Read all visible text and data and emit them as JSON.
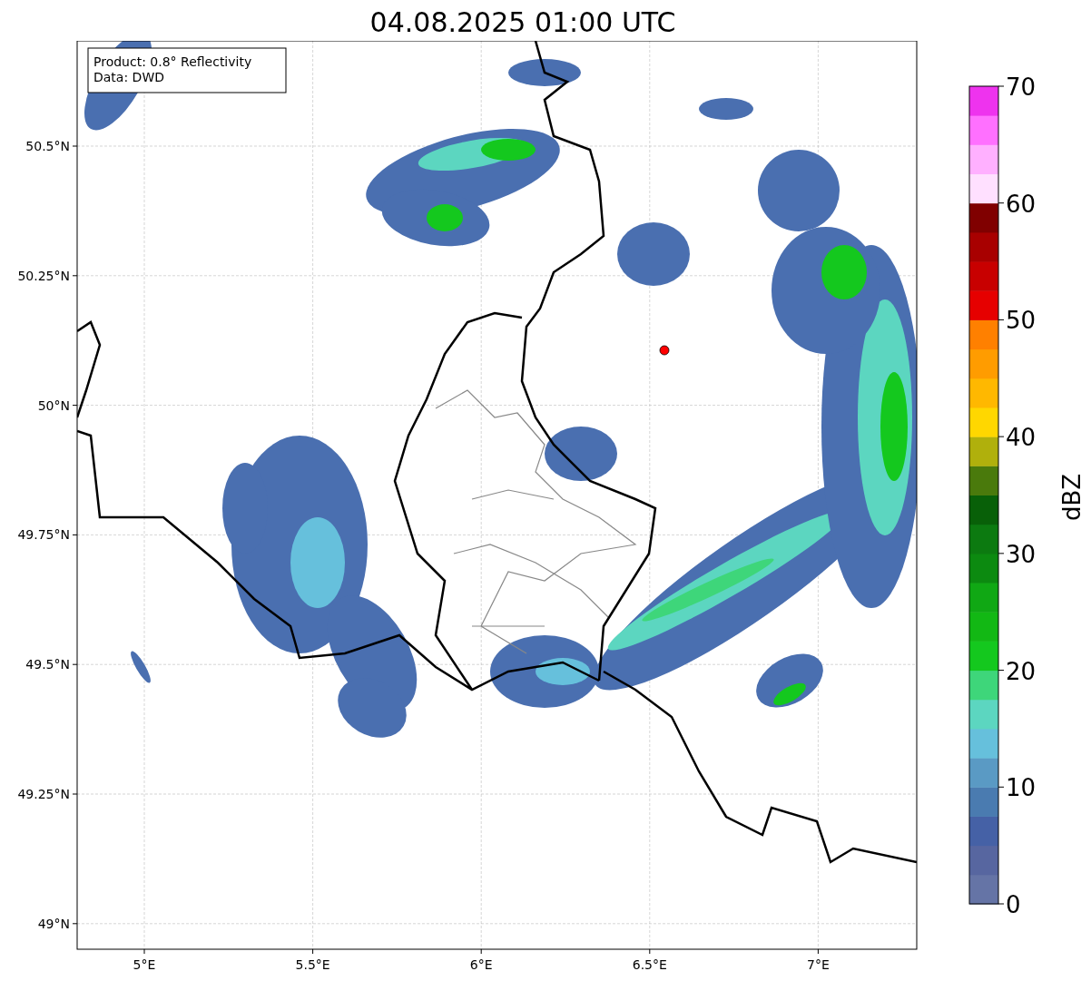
{
  "title": "04.08.2025 01:00 UTC",
  "map": {
    "info": [
      "Product: 0.8° Reflectivity",
      "Data: DWD"
    ],
    "y_ticks": [
      "50.5°N",
      "50.25°N",
      "50°N",
      "49.75°N",
      "49.5°N",
      "49.25°N",
      "49°N"
    ],
    "x_ticks": [
      "5°E",
      "5.5°E",
      "6°E",
      "6.5°E",
      "7°E"
    ]
  },
  "colorbar": {
    "label": "dBZ",
    "ticks": [
      "70",
      "60",
      "50",
      "40",
      "30",
      "20",
      "10",
      "0"
    ],
    "segments": [
      {
        "color": "#6574a6"
      },
      {
        "color": "#5766a0"
      },
      {
        "color": "#4561a6"
      },
      {
        "color": "#4a7bb0"
      },
      {
        "color": "#5a9ac4"
      },
      {
        "color": "#66c0dc"
      },
      {
        "color": "#5cd6c0"
      },
      {
        "color": "#3ed67a"
      },
      {
        "color": "#14c81e"
      },
      {
        "color": "#12b814"
      },
      {
        "color": "#10a814"
      },
      {
        "color": "#0c8a10"
      },
      {
        "color": "#0c7a10"
      },
      {
        "color": "#086008"
      },
      {
        "color": "#4a7a0c"
      },
      {
        "color": "#b0b00c"
      },
      {
        "color": "#ffd700"
      },
      {
        "color": "#ffb800"
      },
      {
        "color": "#ff9c00"
      },
      {
        "color": "#ff8000"
      },
      {
        "color": "#e60000"
      },
      {
        "color": "#c80000"
      },
      {
        "color": "#a80000"
      },
      {
        "color": "#800000"
      },
      {
        "color": "#ffe0ff"
      },
      {
        "color": "#ffb0ff"
      },
      {
        "color": "#ff70ff"
      },
      {
        "color": "#ee33ee"
      }
    ]
  }
}
